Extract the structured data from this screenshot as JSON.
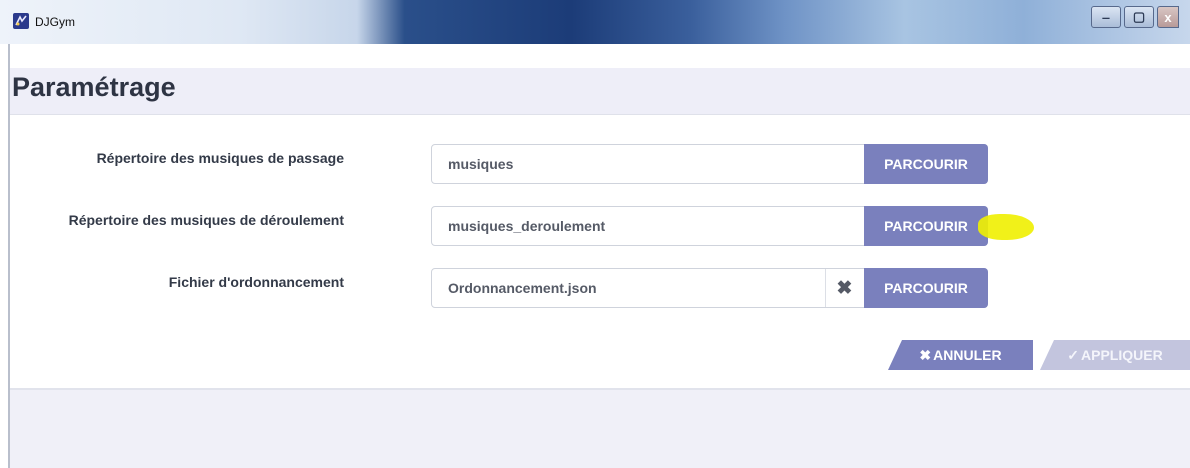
{
  "window": {
    "title": "DJGym",
    "app_icon": "djgym-logo-icon",
    "controls": {
      "minimize": "‒",
      "maximize": "▢",
      "close": "x"
    }
  },
  "page": {
    "title": "Paramétrage"
  },
  "form": {
    "rows": [
      {
        "label": "Répertoire des musiques de passage",
        "value": "musiques",
        "browse_label": "PARCOURIR",
        "has_clear": false
      },
      {
        "label": "Répertoire des musiques de déroulement",
        "value": "musiques_deroulement",
        "browse_label": "PARCOURIR",
        "has_clear": false
      },
      {
        "label": "Fichier d'ordonnancement",
        "value": "Ordonnancement.json",
        "browse_label": "PARCOURIR",
        "has_clear": true,
        "clear_icon": "✖"
      }
    ]
  },
  "actions": {
    "cancel_icon": "✖",
    "cancel_label": "ANNULER",
    "apply_icon": "✓",
    "apply_label": "APPLIQUER"
  },
  "colors": {
    "accent": "#7a80bd",
    "accent_disabled": "#c3c5de",
    "highlight": "#f0f000"
  }
}
